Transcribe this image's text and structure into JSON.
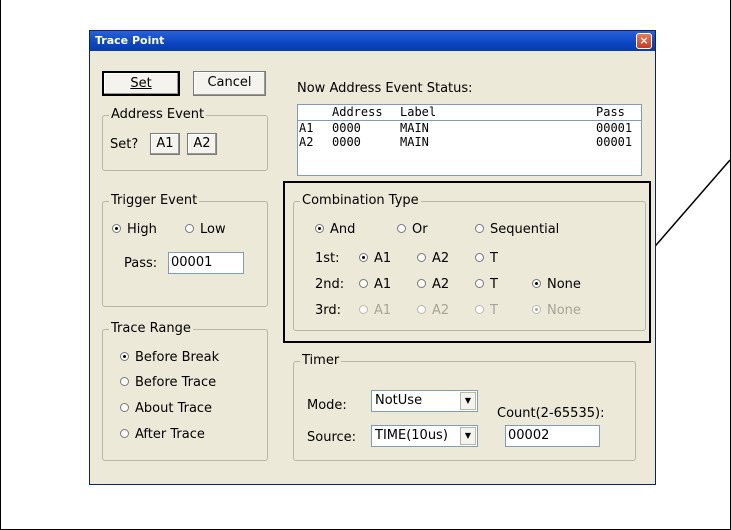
{
  "dialog": {
    "title": "Trace Point",
    "close_icon": "×",
    "set_label": "Set",
    "cancel_label": "Cancel",
    "status_label": "Now Address Event Status:"
  },
  "address_event": {
    "title": "Address Event",
    "set_label": "Set?",
    "a1_label": "A1",
    "a2_label": "A2"
  },
  "status_table": {
    "headers": [
      "",
      "Address",
      "Label",
      "Pass"
    ],
    "rows": [
      [
        "A1",
        "0000",
        "MAIN",
        "00001"
      ],
      [
        "A2",
        "0000",
        "MAIN",
        "00001"
      ]
    ]
  },
  "trigger_event": {
    "title": "Trigger Event",
    "high_label": "High",
    "low_label": "Low",
    "pass_label": "Pass:",
    "pass_value": "00001"
  },
  "combination": {
    "title": "Combination Type",
    "and_label": "And",
    "or_label": "Or",
    "sequential_label": "Sequential",
    "first_label": "1st:",
    "second_label": "2nd:",
    "third_label": "3rd:",
    "a1": "A1",
    "a2": "A2",
    "t": "T",
    "none": "None"
  },
  "trace_range": {
    "title": "Trace Range",
    "before_break": "Before Break",
    "before_trace": "Before Trace",
    "about_trace": "About Trace",
    "after_trace": "After Trace"
  },
  "timer": {
    "title": "Timer",
    "mode_label": "Mode:",
    "mode_value": "NotUse",
    "source_label": "Source:",
    "source_value": "TIME(10us)",
    "count_label": "Count(2-65535):",
    "count_value": "00002",
    "arrow_icon": "▼"
  }
}
